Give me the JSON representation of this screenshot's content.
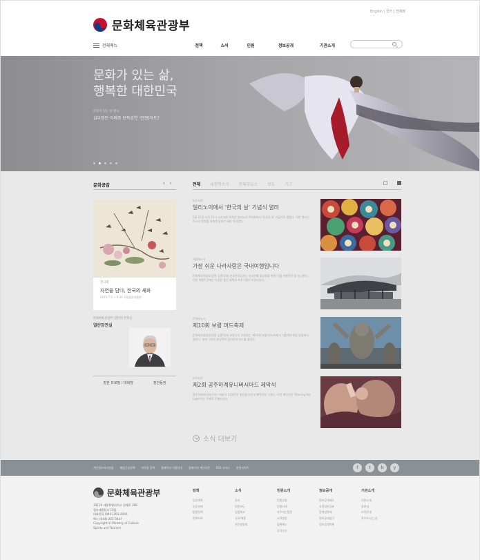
{
  "header": {
    "logo_text": "문화체육관광부",
    "util_links": "English | 국어 | 전체메",
    "all_menu": "전체메뉴",
    "gnb": [
      "정책",
      "소식",
      "민원",
      "정보공개",
      "기관소개"
    ],
    "search_placeholder": ""
  },
  "hero": {
    "title_line1": "문화가 있는 삶,",
    "title_line2": "행복한 대한민국",
    "sub_small": "문화가 있는 날 행사",
    "sub_main": "심우정인 이례주 단독공연 '전엔[아트]'",
    "dots": 5,
    "active_dot": 1
  },
  "culture": {
    "title": "문화공감",
    "prev": "‹",
    "next": "›",
    "card_tag": "전시회",
    "card_title": "자연을 담다, 한국의 새화",
    "card_date": "2015.7.2 ~ 9.20 국립중앙박물관"
  },
  "minister": {
    "tag": "문화체육관광부 장관이 전하는",
    "title": "열린장관실",
    "links": [
      "장관 프로필 / 대화방",
      "장관동정"
    ]
  },
  "news": {
    "tabs": [
      "전체",
      "새정책소식",
      "문체부뉴스",
      "보도",
      "기고"
    ],
    "active_tab": 0,
    "items": [
      {
        "category": "보도자료",
        "title": "일리노이에서 '한국의 날' 기념식 열려",
        "body": "5월 22일 오전 11시 시카고에 위치한 일리노이 주의회에서 '한국의 날' 기념식이 열렸다. 이번 행사는 하나의 문화를 세계에 알리기 위한 자리였다."
      },
      {
        "category": "새정책소식",
        "title": "가장 쉬운 나라사랑은 국내여행입니다",
        "body": "문화체육관광부(장관 김종덕)와 한국관광공사는 국내여행 활성화를 위해 '가을 여행주간'을 실시한다. 이번 여행주간에는 다양한 할인 혜택과 프로그램이 마련되었다."
      },
      {
        "category": "문체부뉴스",
        "title": "제10회 보령 머드축제",
        "body": "문화체육관광부(장관 김종덕)와 보령시가 주최하는 '제10회 보령 머드축제'가 대천해수욕장 일원에서 열린다. 세계 각국의 관광객이 참여하여 머드를 즐긴다."
      },
      {
        "category": "보도자료",
        "title": "제2회 공주하계유니버시아드 체막식",
        "body": "광주하계유니버시아드 대회가 12일간의 열전을 마치고 폐막식을 가졌다. 이번 폐막식은 'Sharing the Light'라는 주제로 진행되었다."
      }
    ],
    "more_label": "소식 더보기"
  },
  "linkbar": {
    "links": [
      "개인정보처리방침",
      "웹접근성정책",
      "저작권 정책",
      "홈페이지 이용안내",
      "홈페이지 개선의견",
      "RSS 서비스",
      "관련사이트"
    ],
    "social": [
      "f",
      "t",
      "b",
      "y"
    ]
  },
  "footer": {
    "logo_text": "문화체육관광부",
    "addr1": "30119 세종특별자치시 갈매로 388",
    "addr2": "정부세종청사 15동",
    "tel": "대표전화 (044) 203-2000",
    "fax": "팩스 (044) 203-3447",
    "copyright1": "Copyright © Ministry of Culture",
    "copyright2": "Sports and Tourism",
    "columns": [
      {
        "title": "정책",
        "links": [
          "업무계획",
          "추진과제",
          "법령정책",
          "정책자료"
        ]
      },
      {
        "title": "소식",
        "links": [
          "공지",
          "언론보도",
          "입법예고",
          "공모/채용",
          "전문설명회"
        ]
      },
      {
        "title": "민원소개",
        "links": [
          "민원신청",
          "민원사례",
          "자주하는질문",
          "고객헌장",
          "불편해소",
          "공익신고"
        ]
      },
      {
        "title": "정보공개",
        "links": [
          "정보공개제도",
          "사전정보공표",
          "정책실명제",
          "정보공개청구",
          "정보공개목록"
        ]
      },
      {
        "title": "기관소개",
        "links": [
          "기관소개",
          "장관실",
          "조직안내",
          "찾아오시는 길"
        ]
      }
    ]
  }
}
